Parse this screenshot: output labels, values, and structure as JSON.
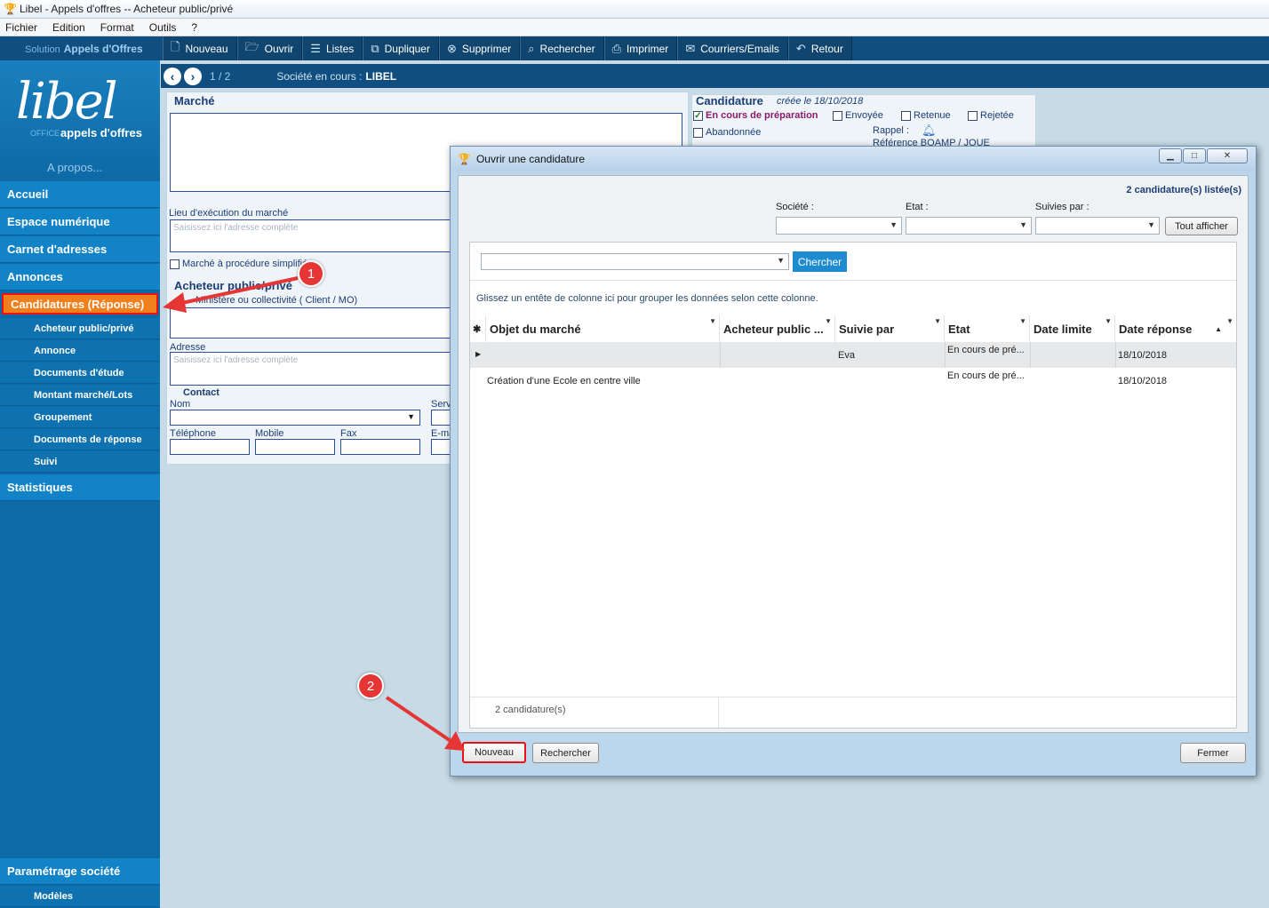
{
  "window": {
    "title": "Libel - Appels d'offres -- Acheteur public/privé"
  },
  "menu": [
    "Fichier",
    "Edition",
    "Format",
    "Outils",
    "?"
  ],
  "toolbar": {
    "brand_prefix": "Solution",
    "brand_name": "Appels d'Offres",
    "buttons": [
      {
        "label": "Nouveau",
        "icon": "new-document-icon"
      },
      {
        "label": "Ouvrir",
        "icon": "folder-open-icon"
      },
      {
        "label": "Listes",
        "icon": "list-icon"
      },
      {
        "label": "Dupliquer",
        "icon": "duplicate-icon"
      },
      {
        "label": "Supprimer",
        "icon": "delete-icon"
      },
      {
        "label": "Rechercher",
        "icon": "search-icon"
      },
      {
        "label": "Imprimer",
        "icon": "printer-icon"
      },
      {
        "label": "Courriers/Emails",
        "icon": "mail-icon"
      },
      {
        "label": "Retour",
        "icon": "undo-icon"
      }
    ]
  },
  "logo": {
    "name": "libel",
    "office": "OFFICE",
    "product": "appels d'offres",
    "about": "A propos..."
  },
  "sidebar": {
    "items": [
      "Accueil",
      "Espace numérique",
      "Carnet d'adresses",
      "Annonces",
      "Candidatures (Réponse)"
    ],
    "subitems": [
      "Acheteur public/privé",
      "Annonce",
      "Documents d'étude",
      "Montant marché/Lots",
      "Groupement",
      "Documents de réponse",
      "Suivi"
    ],
    "stats": "Statistiques",
    "settings": "Paramétrage société",
    "models": "Modèles"
  },
  "pager": {
    "page": "1 / 2",
    "company_label": "Société en cours :",
    "company": "LIBEL"
  },
  "form": {
    "marche": "Marché",
    "lieu": "Lieu d'exécution du marché",
    "lieu_ph": "Saisissez ici l'adresse complète",
    "procedure": "Marché à procédure simplifiée",
    "acheteur": "Acheteur public/privé",
    "ministere": "Ministère ou collectivité ( Client / MO)",
    "adresse": "Adresse",
    "adresse_ph": "Saisissez ici l'adresse complète",
    "contact": "Contact",
    "nom": "Nom",
    "serv": "Serv",
    "telephone": "Téléphone",
    "mobile": "Mobile",
    "fax": "Fax",
    "email": "E-ma"
  },
  "candidature": {
    "title": "Candidature",
    "created": "créée le 18/10/2018",
    "status": [
      "En cours de préparation",
      "Envoyée",
      "Retenue",
      "Rejetée",
      "Abandonnée"
    ],
    "rappel": "Rappel :",
    "ref": "Référence BOAMP / JOUE"
  },
  "dialog": {
    "title": "Ouvrir une candidature",
    "count": "2 candidature(s) listée(s)",
    "societe": "Société :",
    "etat": "Etat :",
    "suivies": "Suivies par :",
    "tout_afficher": "Tout afficher",
    "chercher": "Chercher",
    "group_hint": "Glissez un entête de colonne ici pour grouper les données selon cette colonne.",
    "columns": [
      "Objet du marché",
      "Acheteur public ...",
      "Suivie par",
      "Etat",
      "Date limite",
      "Date réponse"
    ],
    "rows": [
      [
        "",
        "",
        "Eva",
        "En cours de pré...",
        "",
        "18/10/2018"
      ],
      [
        "Création d'une Ecole en centre ville",
        "",
        "",
        "En cours de pré...",
        "",
        "18/10/2018"
      ]
    ],
    "footer_count": "2 candidature(s)",
    "nouveau": "Nouveau",
    "rechercher": "Rechercher",
    "fermer": "Fermer"
  },
  "annotations": [
    "1",
    "2"
  ],
  "colors": {
    "accent": "#1283c6",
    "toolbar": "#0f4e7e",
    "highlight": "#f07f1c",
    "arrow": "#e53535"
  }
}
